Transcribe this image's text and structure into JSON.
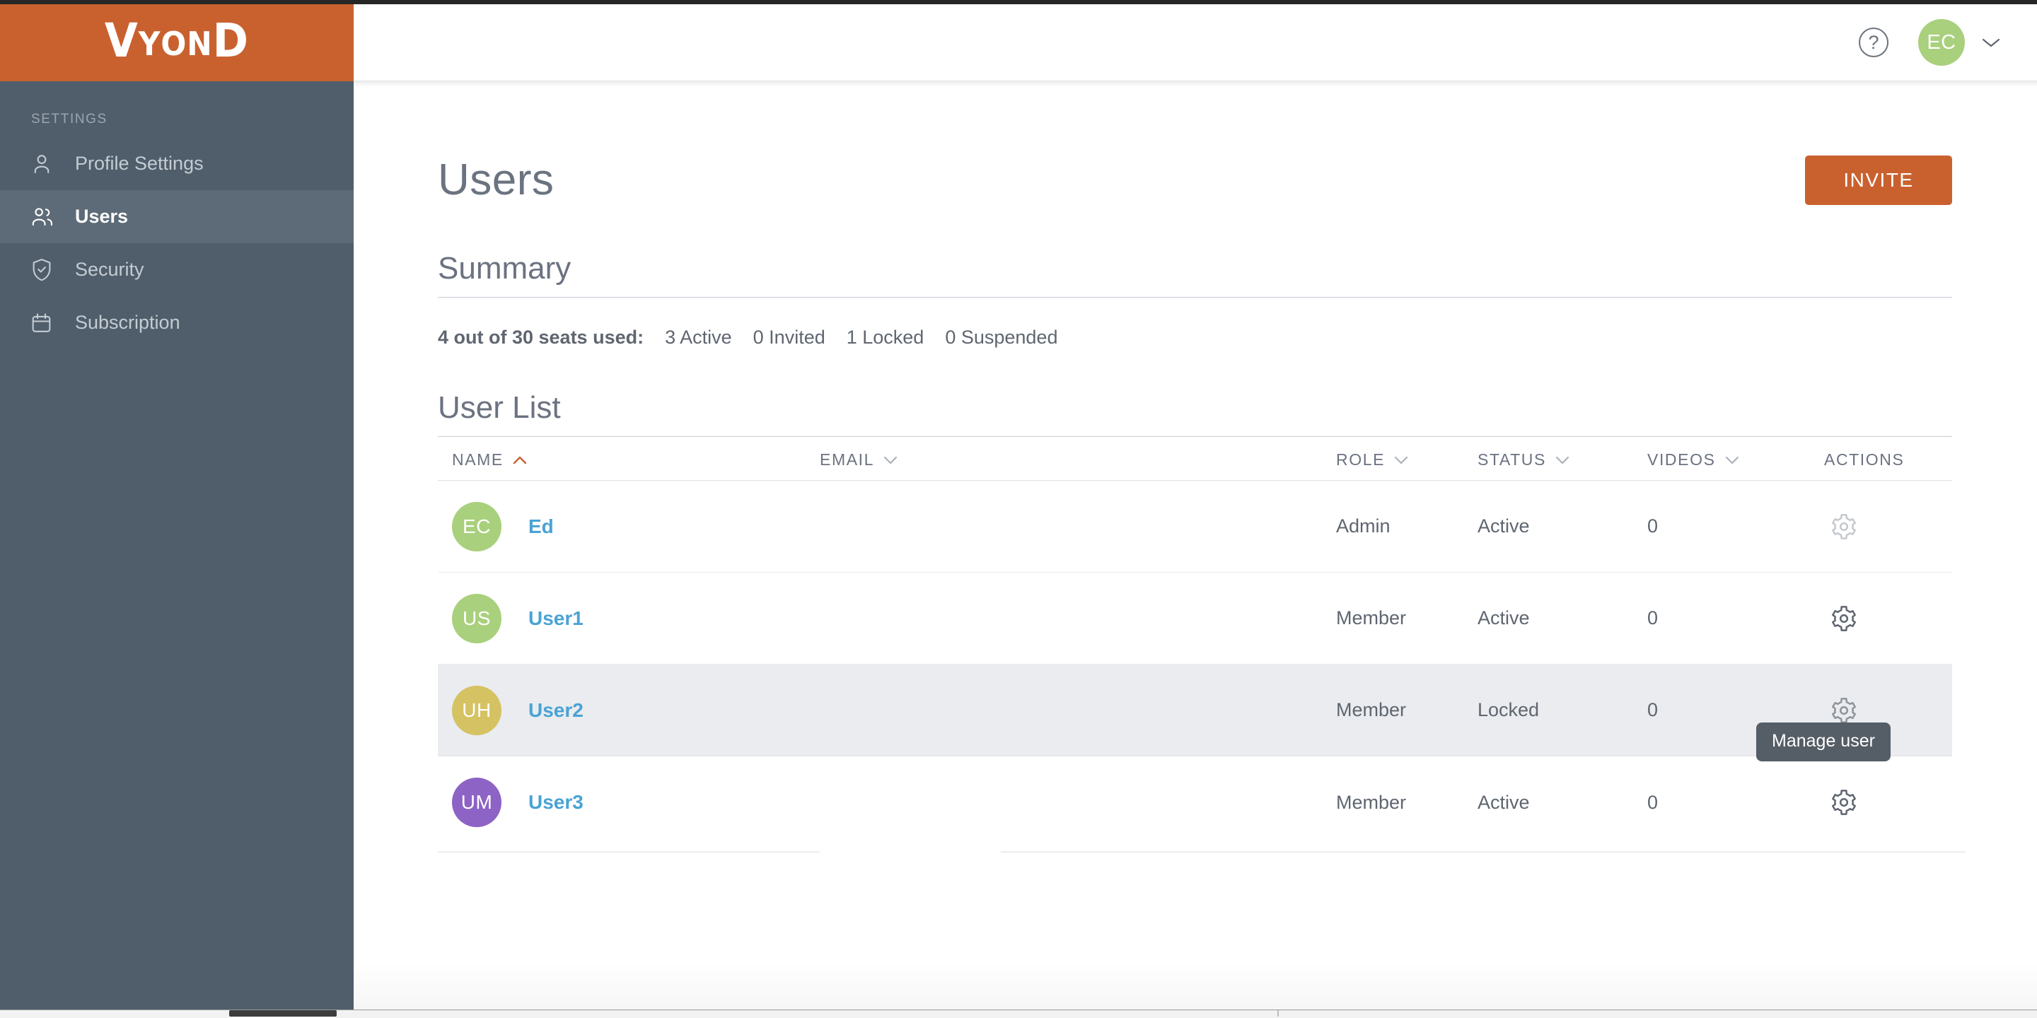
{
  "brand": {
    "logo_big_1": "V",
    "logo_small_1": "Y",
    "logo_small_2": "O",
    "logo_small_3": "N",
    "logo_big_2": "D",
    "color": "#c9612f"
  },
  "sidebar": {
    "section_label": "SETTINGS",
    "background_color": "#505e6b",
    "active_background_color": "#5d6b78",
    "items": [
      {
        "label": "Profile Settings",
        "icon": "user-icon",
        "active": false
      },
      {
        "label": "Users",
        "icon": "users-icon",
        "active": true
      },
      {
        "label": "Security",
        "icon": "shield-check-icon",
        "active": false
      },
      {
        "label": "Subscription",
        "icon": "calendar-icon",
        "active": false
      }
    ]
  },
  "topbar": {
    "help_label": "?",
    "avatar_initials": "EC",
    "avatar_color": "#a9d07c",
    "caret_icon": "chevron-down-icon"
  },
  "page": {
    "title": "Users",
    "invite_label": "INVITE",
    "invite_color": "#c9612f"
  },
  "summary": {
    "title": "Summary",
    "seats_text": "4 out of 30 seats used:",
    "active_text": "3 Active",
    "invited_text": "0 Invited",
    "locked_text": "1 Locked",
    "suspended_text": "0 Suspended"
  },
  "user_list": {
    "title": "User List",
    "columns": [
      {
        "label": "NAME",
        "sort": "asc",
        "sort_active": true
      },
      {
        "label": "EMAIL",
        "sort": "desc",
        "sort_active": false
      },
      {
        "label": "ROLE",
        "sort": "desc",
        "sort_active": false
      },
      {
        "label": "STATUS",
        "sort": "desc",
        "sort_active": false
      },
      {
        "label": "VIDEOS",
        "sort": "desc",
        "sort_active": false
      },
      {
        "label": "ACTIONS",
        "sort": "none",
        "sort_active": false
      }
    ],
    "sort_active_color": "#c9612f",
    "rows": [
      {
        "initials": "EC",
        "avatar_color": "#a9d07c",
        "name": "Ed",
        "email": "",
        "role": "Admin",
        "status": "Active",
        "videos": "0",
        "highlighted": false
      },
      {
        "initials": "US",
        "avatar_color": "#a9d07c",
        "name": "User1",
        "email": "",
        "role": "Member",
        "status": "Active",
        "videos": "0",
        "highlighted": false
      },
      {
        "initials": "UH",
        "avatar_color": "#d5c262",
        "name": "User2",
        "email": "",
        "role": "Member",
        "status": "Locked",
        "videos": "0",
        "highlighted": true
      },
      {
        "initials": "UM",
        "avatar_color": "#8d63c6",
        "name": "User3",
        "email": "",
        "role": "Member",
        "status": "Active",
        "videos": "0",
        "highlighted": false
      }
    ]
  },
  "tooltip": {
    "text": "Manage user"
  }
}
